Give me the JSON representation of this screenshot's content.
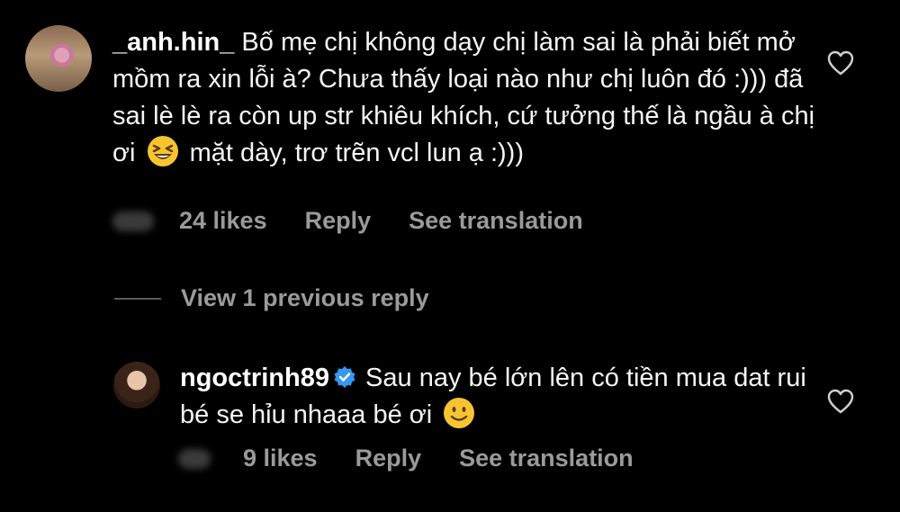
{
  "comments": [
    {
      "username": "_anh.hin_",
      "text_part1": "Bố mẹ chị không dạy chị làm sai là phải biết mở mồm ra xin lỗi à? Chưa thấy loại nào như chị luôn đó :))) đã sai lè lè ra còn up str khiêu khích, cứ tưởng thế là ngầu à chị ơi",
      "emoji": "laughing-squint",
      "text_part2": "mặt dày, trơ trẽn vcl lun ạ :)))",
      "likes": "24 likes",
      "reply": "Reply",
      "translate": "See translation"
    },
    {
      "username": "ngoctrinh89",
      "verified": true,
      "text_part1": "Sau nay bé lớn lên có tiền mua dat rui bé se hỉu nhaaa bé ơi",
      "emoji": "slightly-smiling",
      "likes": "9 likes",
      "reply": "Reply",
      "translate": "See translation"
    }
  ],
  "view_replies": "View 1 previous reply",
  "colors": {
    "background": "#000000",
    "text": "#f5f5f5",
    "meta": "#9a9a9a",
    "verified": "#3897f0"
  }
}
